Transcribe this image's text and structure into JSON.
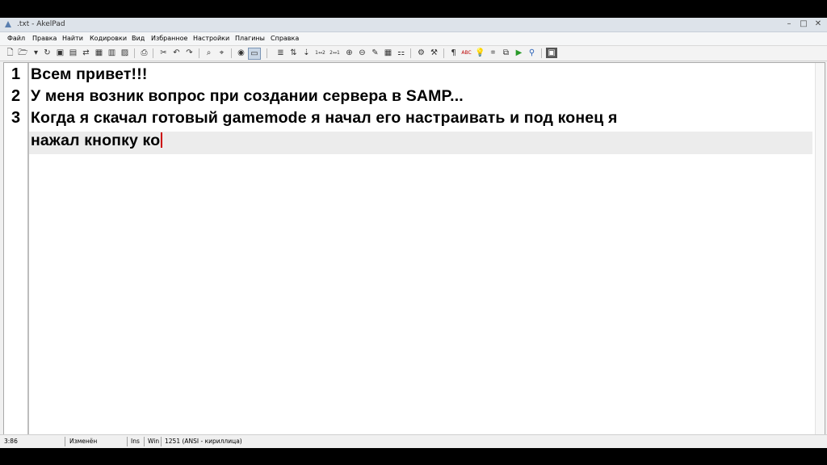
{
  "window": {
    "title": ".txt - AkelPad",
    "controls": {
      "minimize": "–",
      "maximize": "□",
      "close": "✕"
    }
  },
  "menu": [
    "Файл",
    "Правка",
    "Найти",
    "Кодировки",
    "Вид",
    "Избранное",
    "Настройки",
    "Плагины",
    "Справка"
  ],
  "toolbar": {
    "icons": [
      "new-file-icon",
      "open-file-icon",
      "open-dropdown-icon",
      "reopen-icon",
      "save-icon",
      "save-as-icon",
      "save-all-icon",
      "print-icon",
      "undo-icon",
      "redo-icon",
      "find-icon",
      "replace-icon",
      "go-to-icon",
      "word-wrap-icon",
      "case-icon",
      "ins-ovr-icon",
      "sort-icon",
      "scroll-icon",
      "macro-icon",
      "check-spelling-icon",
      "highlight-icon",
      "run-icon",
      "settings-icon",
      "paragraph-icon",
      "abc-icon",
      "bulb-icon",
      "copy-icon",
      "play-icon",
      "link-icon",
      "fullscreen-icon"
    ]
  },
  "editor": {
    "line_numbers": [
      "1",
      "2",
      "3"
    ],
    "lines": [
      "Всем привет!!!",
      "У меня возник вопрос при создании сервера в SAMP...",
      "Когда я скачал готовый gamemode я начал его настраивать и под конец я",
      "нажал кнопку ко"
    ]
  },
  "status": {
    "position": "3:86",
    "modified": "Изменён",
    "insert_mode": "Ins",
    "newline": "Win",
    "encoding": "1251  (ANSI - кириллица)"
  }
}
